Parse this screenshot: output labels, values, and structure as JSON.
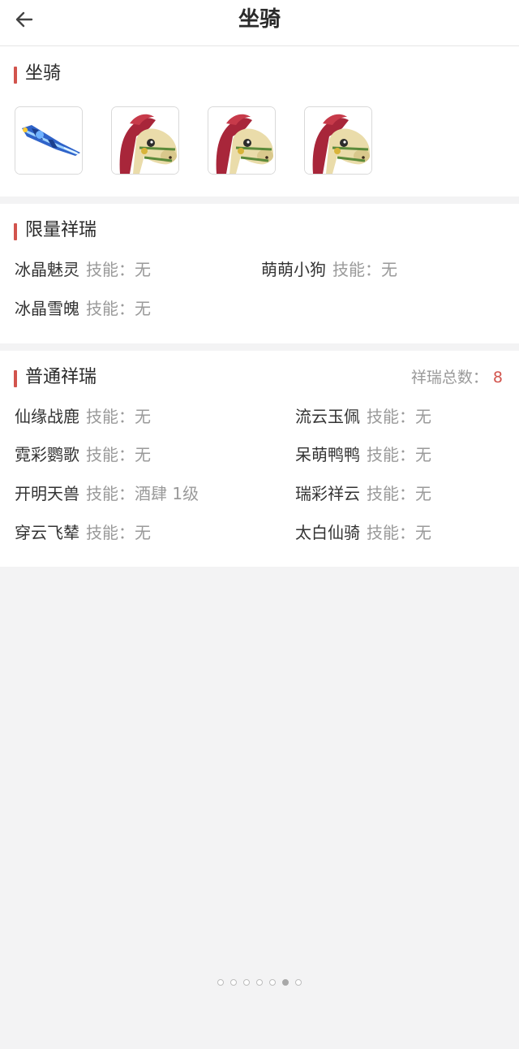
{
  "header": {
    "title": "坐骑",
    "back_icon": "arrow-left-icon"
  },
  "mounts": {
    "title": "坐骑",
    "icons": [
      {
        "name": "blue-sword-mount-icon"
      },
      {
        "name": "horse-mount-icon"
      },
      {
        "name": "horse-mount-icon"
      },
      {
        "name": "horse-mount-icon"
      }
    ]
  },
  "limited": {
    "title": "限量祥瑞",
    "items": [
      {
        "name": "冰晶魅灵",
        "skill": "技能：无"
      },
      {
        "name": "萌萌小狗",
        "skill": "技能：无"
      },
      {
        "name": "冰晶雪魄",
        "skill": "技能：无"
      }
    ]
  },
  "normal": {
    "title": "普通祥瑞",
    "total_label": "祥瑞总数：",
    "total_value": "8",
    "items": [
      {
        "name": "仙缘战鹿",
        "skill": "技能：无"
      },
      {
        "name": "流云玉佩",
        "skill": "技能：无"
      },
      {
        "name": "霓彩鹦歌",
        "skill": "技能：无"
      },
      {
        "name": "呆萌鸭鸭",
        "skill": "技能：无"
      },
      {
        "name": "开明天兽",
        "skill": "技能：酒肆 1级"
      },
      {
        "name": "瑞彩祥云",
        "skill": "技能：无"
      },
      {
        "name": "穿云飞辇",
        "skill": "技能：无"
      },
      {
        "name": "太白仙骑",
        "skill": "技能：无"
      }
    ]
  },
  "pager": {
    "count": 7,
    "active_index": 5
  },
  "colors": {
    "accent": "#d2544d",
    "background": "#f3f3f4"
  }
}
